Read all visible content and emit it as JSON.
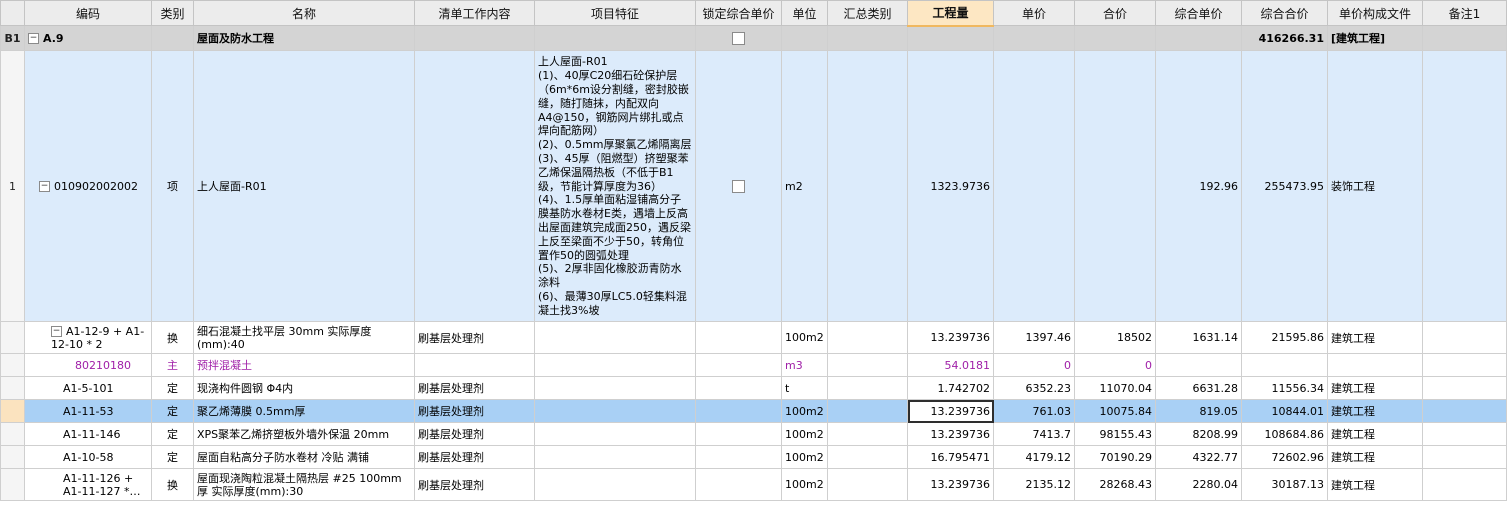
{
  "columns": [
    "编码",
    "类别",
    "名称",
    "清单工作内容",
    "项目特征",
    "锁定综合单价",
    "单位",
    "汇总类别",
    "工程量",
    "单价",
    "合价",
    "综合单价",
    "综合合价",
    "单价构成文件",
    "备注1"
  ],
  "section": {
    "rowno": "B1",
    "code": "A.9",
    "name": "屋面及防水工程",
    "total": "416266.31",
    "file": "[建筑工程]"
  },
  "main_item": {
    "rowno": "1",
    "code": "010902002002",
    "type": "项",
    "name": "上人屋面-R01",
    "features": "上人屋面-R01\n(1)、40厚C20细石砼保护层（6m*6m设分割缝，密封胶嵌缝，随打随抹，内配双向A4@150，钢筋网片绑扎或点焊向配筋网）\n(2)、0.5mm厚聚氯乙烯隔离层\n(3)、45厚（阻燃型）挤塑聚苯乙烯保温隔热板（不低于B1级，节能计算厚度为36）\n(4)、1.5厚单面粘湿铺高分子膜基防水卷材E类，遇墙上反高出屋面建筑完成面250，遇反梁上反至梁面不少于50，转角位置作50的圆弧处理\n(5)、2厚非固化橡胶沥青防水涂料\n(6)、最薄30厚LC5.0轻集料混凝土找3%坡",
    "unit": "m2",
    "qty": "1323.9736",
    "comp_price": "192.96",
    "comp_total": "255473.95",
    "file": "装饰工程"
  },
  "sub_rows": [
    {
      "code": "A1-12-9 + A1-12-10 * 2",
      "type": "换",
      "name": "细石混凝土找平层 30mm  实际厚度(mm):40",
      "work": "刷基层处理剂",
      "unit": "100m2",
      "qty": "13.239736",
      "price": "1397.46",
      "total": "18502",
      "comp_price": "1631.14",
      "comp_total": "21595.86",
      "file": "建筑工程"
    },
    {
      "code": "80210180",
      "type": "主",
      "name": "预拌混凝土",
      "work": "",
      "unit": "m3",
      "qty": "54.0181",
      "price": "0",
      "total": "0",
      "comp_price": "",
      "comp_total": "",
      "file": ""
    },
    {
      "code": "A1-5-101",
      "type": "定",
      "name": "现浇构件圆钢 Φ4内",
      "work": "刷基层处理剂",
      "unit": "t",
      "qty": "1.742702",
      "price": "6352.23",
      "total": "11070.04",
      "comp_price": "6631.28",
      "comp_total": "11556.34",
      "file": "建筑工程"
    },
    {
      "code": "A1-11-53",
      "type": "定",
      "name": "聚乙烯薄膜 0.5mm厚",
      "work": "刷基层处理剂",
      "unit": "100m2",
      "qty": "13.239736",
      "price": "761.03",
      "total": "10075.84",
      "comp_price": "819.05",
      "comp_total": "10844.01",
      "file": "建筑工程"
    },
    {
      "code": "A1-11-146",
      "type": "定",
      "name": "XPS聚苯乙烯挤塑板外墙外保温 20mm",
      "work": "刷基层处理剂",
      "unit": "100m2",
      "qty": "13.239736",
      "price": "7413.7",
      "total": "98155.43",
      "comp_price": "8208.99",
      "comp_total": "108684.86",
      "file": "建筑工程"
    },
    {
      "code": "A1-10-58",
      "type": "定",
      "name": "屋面自粘高分子防水卷材 冷贴 满铺",
      "work": "刷基层处理剂",
      "unit": "100m2",
      "qty": "16.795471",
      "price": "4179.12",
      "total": "70190.29",
      "comp_price": "4322.77",
      "comp_total": "72602.96",
      "file": "建筑工程"
    },
    {
      "code": "A1-11-126 + A1-11-127 *…",
      "type": "换",
      "name": "屋面现浇陶粒混凝土隔热层 #25 100mm厚  实际厚度(mm):30",
      "work": "刷基层处理剂",
      "unit": "100m2",
      "qty": "13.239736",
      "price": "2135.12",
      "total": "28268.43",
      "comp_price": "2280.04",
      "comp_total": "30187.13",
      "file": "建筑工程"
    }
  ],
  "icons": {
    "expanded": "minus-square-icon",
    "checkbox": "checkbox-icon"
  }
}
